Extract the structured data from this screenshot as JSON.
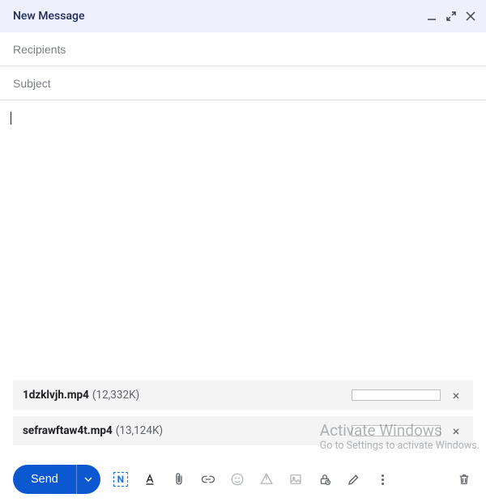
{
  "header": {
    "title": "New Message"
  },
  "fields": {
    "recipients_placeholder": "Recipients",
    "recipients_value": "",
    "subject_placeholder": "Subject",
    "subject_value": ""
  },
  "body": {
    "content": ""
  },
  "attachments": [
    {
      "name": "1dzklvjh.mp4",
      "size": "(12,332K)"
    },
    {
      "name": "sefrawftaw4t.mp4",
      "size": "(13,124K)"
    }
  ],
  "toolbar": {
    "send_label": "Send",
    "format_initial": "N"
  },
  "watermark": {
    "title": "Activate Windows",
    "subtitle": "Go to Settings to activate Windows."
  }
}
